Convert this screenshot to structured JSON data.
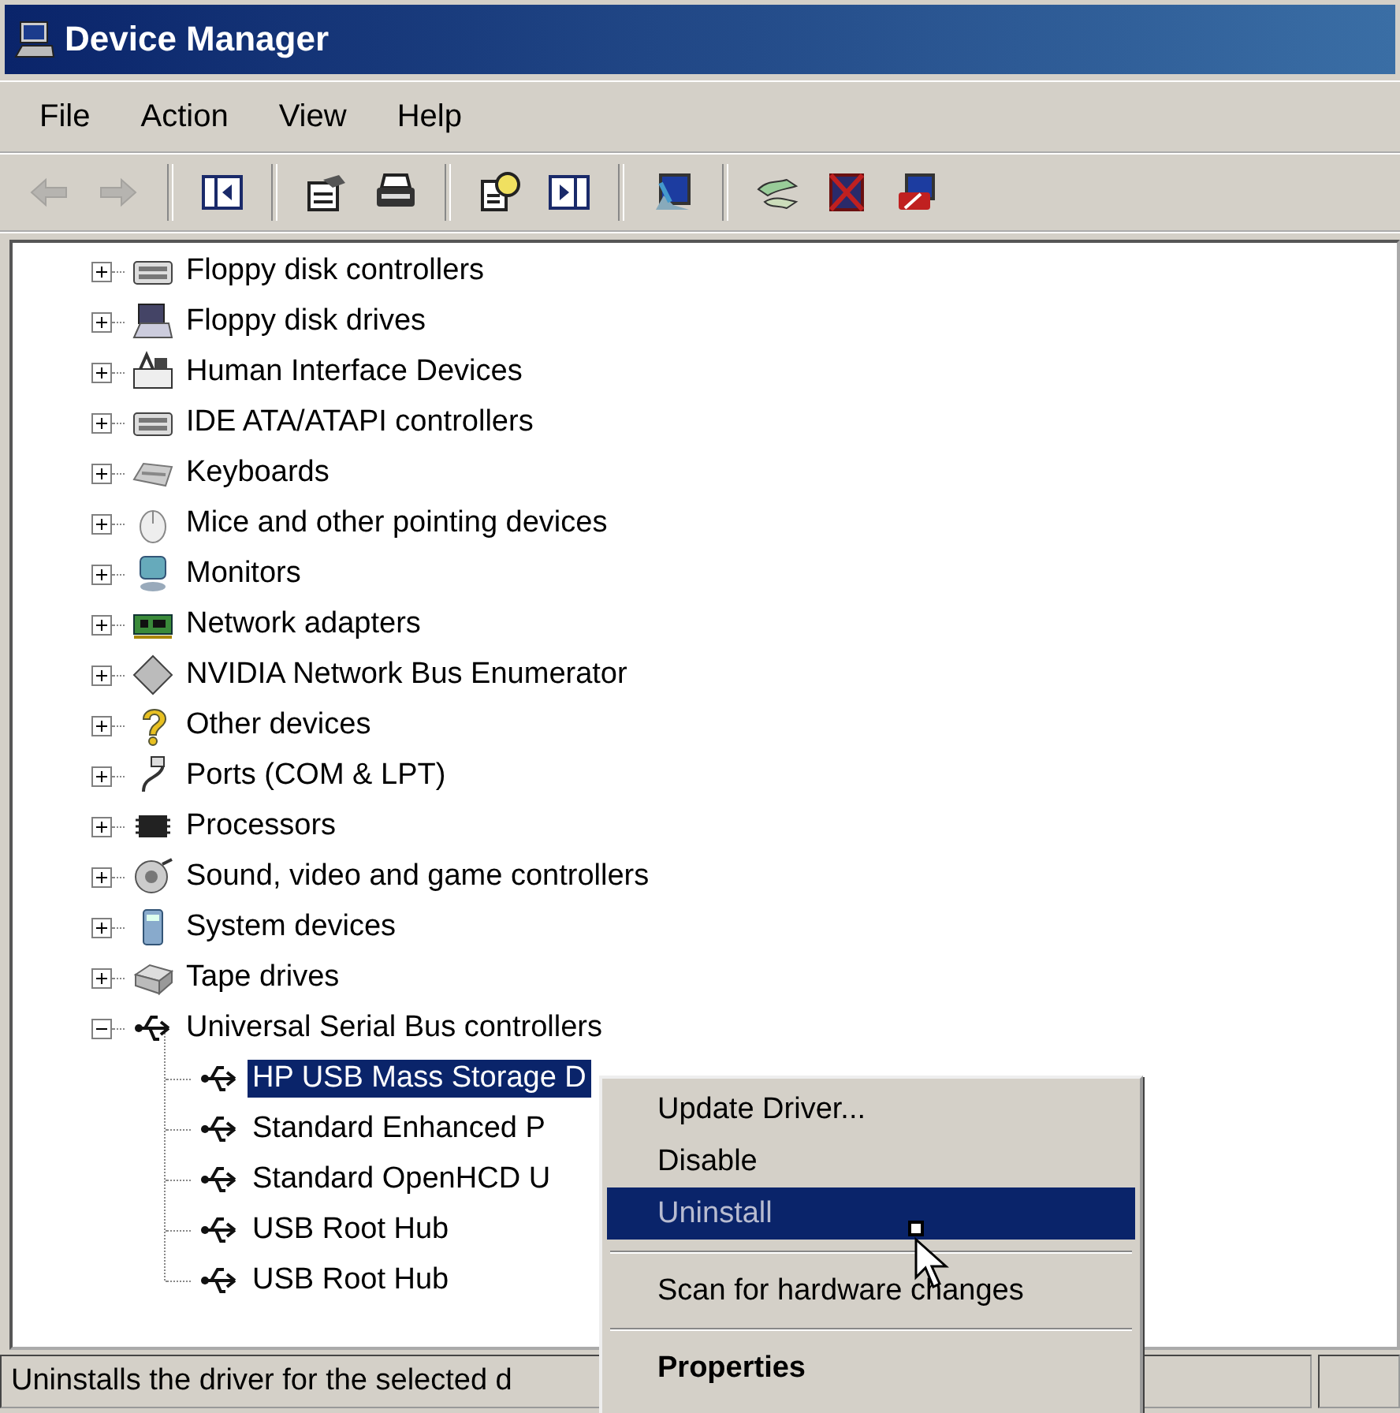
{
  "window": {
    "title": "Device Manager"
  },
  "menu_bar": [
    {
      "label": "File"
    },
    {
      "label": "Action"
    },
    {
      "label": "View"
    },
    {
      "label": "Help"
    }
  ],
  "toolbar": [
    {
      "kind": "back",
      "disabled": true
    },
    {
      "kind": "forward",
      "disabled": true
    },
    {
      "kind": "separator"
    },
    {
      "kind": "tree-toggle"
    },
    {
      "kind": "separator"
    },
    {
      "kind": "properties"
    },
    {
      "kind": "print"
    },
    {
      "kind": "separator"
    },
    {
      "kind": "help"
    },
    {
      "kind": "pane-toggle"
    },
    {
      "kind": "separator"
    },
    {
      "kind": "scan"
    },
    {
      "kind": "separator"
    },
    {
      "kind": "update"
    },
    {
      "kind": "uninstall"
    },
    {
      "kind": "disable"
    }
  ],
  "tree": [
    {
      "label": "Floppy disk controllers",
      "kind": "controller",
      "expanded": false
    },
    {
      "label": "Floppy disk drives",
      "kind": "drive",
      "expanded": false
    },
    {
      "label": "Human Interface Devices",
      "kind": "hid",
      "expanded": false
    },
    {
      "label": "IDE ATA/ATAPI controllers",
      "kind": "controller",
      "expanded": false
    },
    {
      "label": "Keyboards",
      "kind": "keyboard",
      "expanded": false
    },
    {
      "label": "Mice and other pointing devices",
      "kind": "mouse",
      "expanded": false
    },
    {
      "label": "Monitors",
      "kind": "monitor",
      "expanded": false
    },
    {
      "label": "Network adapters",
      "kind": "network",
      "expanded": false
    },
    {
      "label": "NVIDIA Network Bus Enumerator",
      "kind": "diamond",
      "expanded": false
    },
    {
      "label": "Other devices",
      "kind": "unknown",
      "expanded": false
    },
    {
      "label": "Ports (COM & LPT)",
      "kind": "port",
      "expanded": false
    },
    {
      "label": "Processors",
      "kind": "chip",
      "expanded": false
    },
    {
      "label": "Sound, video and game controllers",
      "kind": "sound",
      "expanded": false
    },
    {
      "label": "System devices",
      "kind": "system",
      "expanded": false
    },
    {
      "label": "Tape drives",
      "kind": "tape",
      "expanded": false
    },
    {
      "label": "Universal Serial Bus controllers",
      "kind": "usb",
      "expanded": true,
      "children": [
        {
          "label": "HP USB Mass Storage D",
          "kind": "usb",
          "selected": true
        },
        {
          "label": "Standard Enhanced P",
          "kind": "usb",
          "selected": false
        },
        {
          "label": "Standard OpenHCD U",
          "kind": "usb",
          "selected": false
        },
        {
          "label": "USB Root Hub",
          "kind": "usb",
          "selected": false
        },
        {
          "label": "USB Root Hub",
          "kind": "usb",
          "selected": false
        }
      ]
    }
  ],
  "context_menu": [
    {
      "kind": "item",
      "label": "Update Driver...",
      "selected": false,
      "default": false
    },
    {
      "kind": "item",
      "label": "Disable",
      "selected": false,
      "default": false
    },
    {
      "kind": "item",
      "label": "Uninstall",
      "selected": true,
      "default": false
    },
    {
      "kind": "separator"
    },
    {
      "kind": "item",
      "label": "Scan for hardware changes",
      "selected": false,
      "default": false
    },
    {
      "kind": "separator"
    },
    {
      "kind": "item",
      "label": "Properties",
      "selected": false,
      "default": true
    }
  ],
  "status_bar": {
    "text": "Uninstalls the driver for the selected d"
  }
}
